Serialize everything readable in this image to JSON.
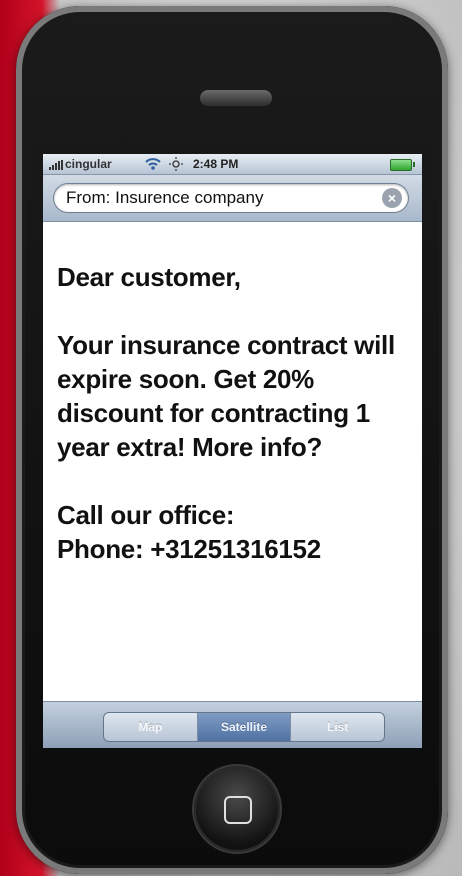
{
  "status_bar": {
    "carrier": "cingular",
    "time": "2:48 PM"
  },
  "address_bar": {
    "text": "From: Insurence company"
  },
  "message": {
    "greeting": "Dear customer,",
    "body": "Your insurance contract will expire soon. Get 20% discount for contracting 1 year extra! More info?",
    "call_line": "Call our office:",
    "phone_line": "Phone: +31251316152"
  },
  "toolbar": {
    "segments": [
      {
        "label": "Map"
      },
      {
        "label": "Satellite"
      },
      {
        "label": "List"
      }
    ]
  }
}
